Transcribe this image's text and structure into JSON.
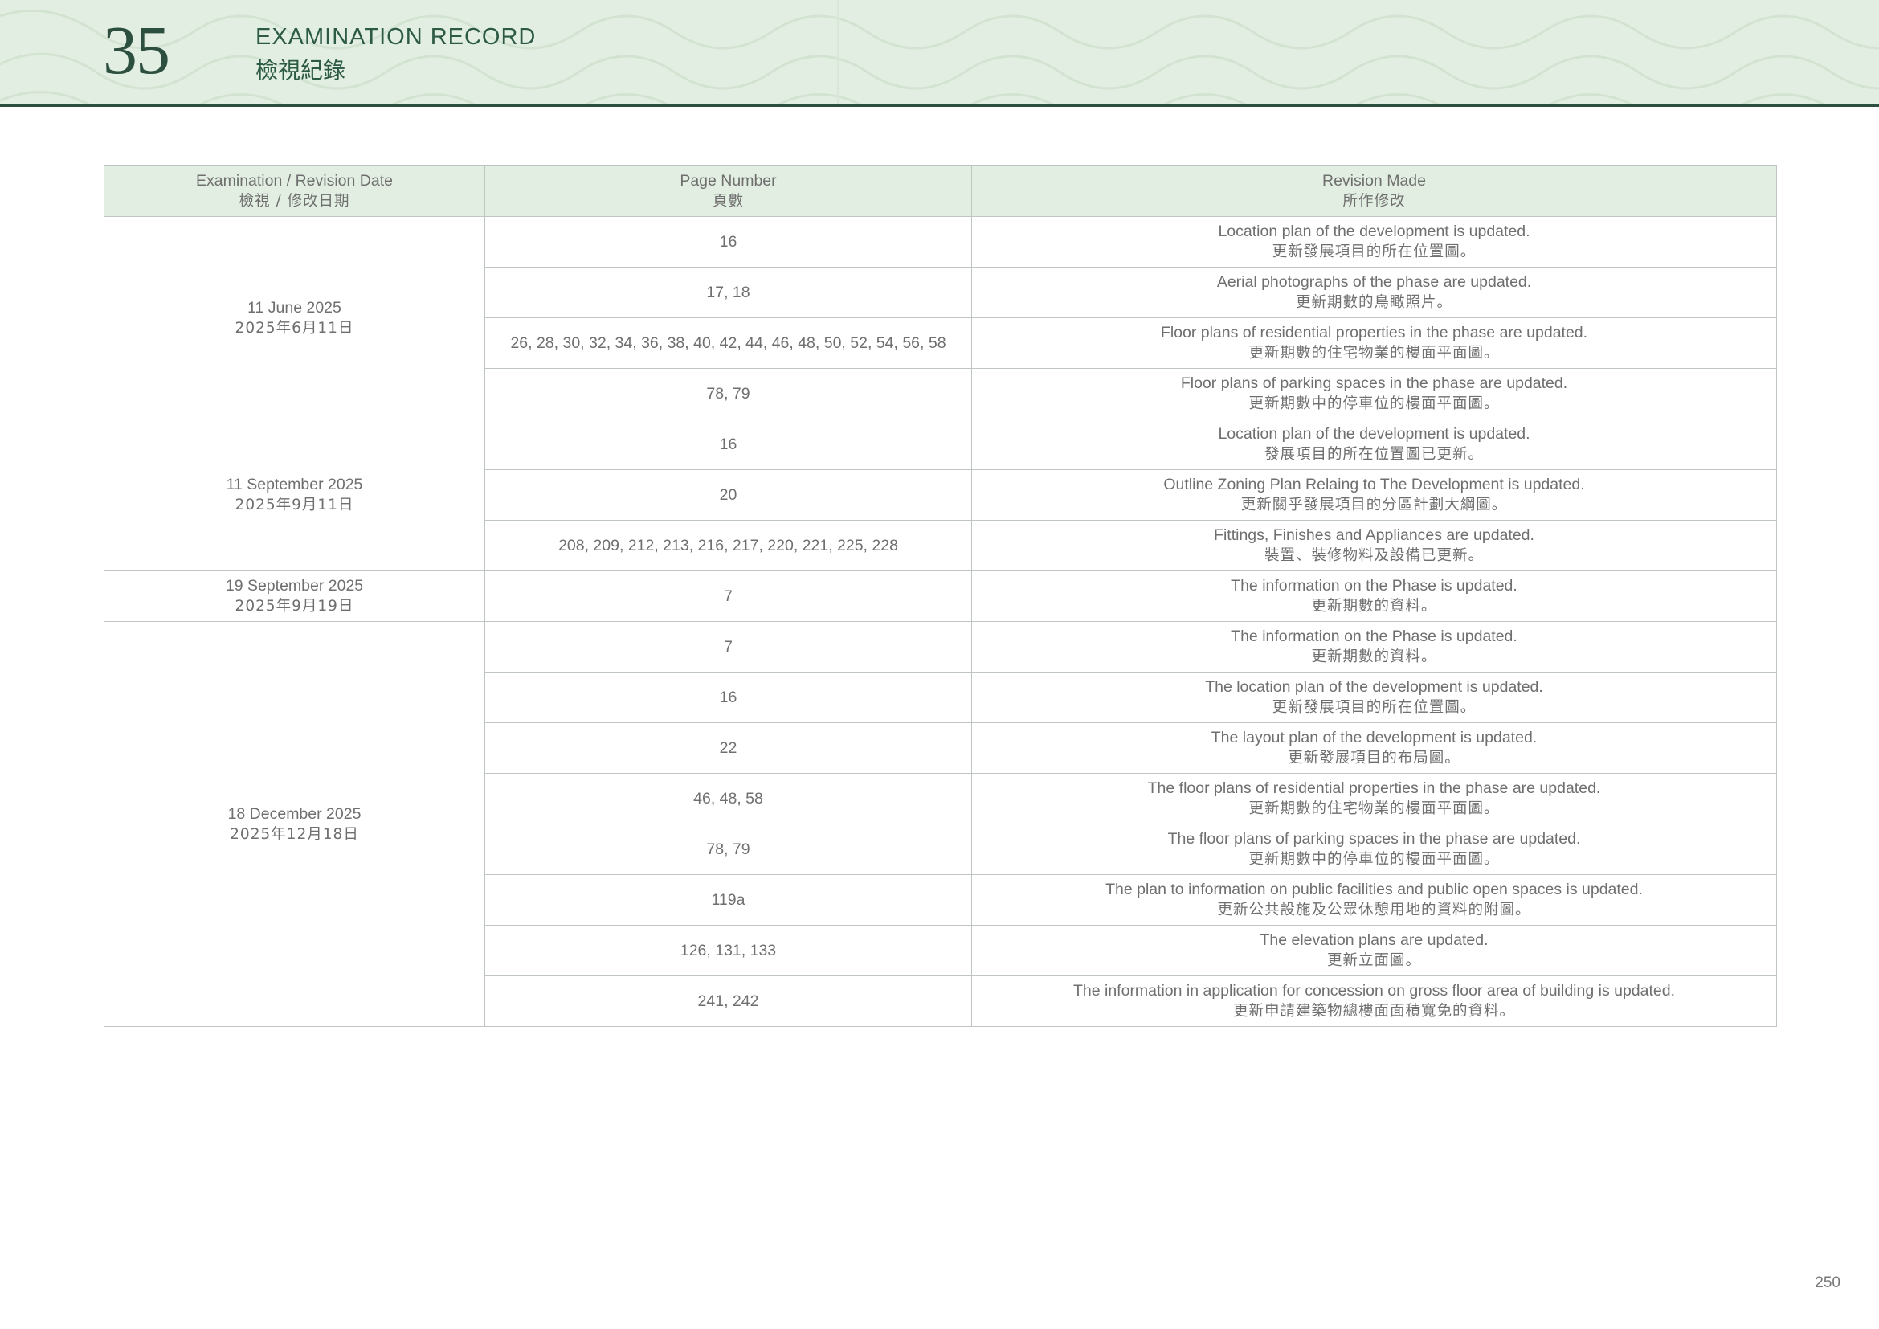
{
  "header": {
    "section_number": "35",
    "title_en": "EXAMINATION RECORD",
    "title_zh": "檢視紀錄"
  },
  "table": {
    "columns": [
      {
        "en": "Examination / Revision Date",
        "zh": "檢視 / 修改日期"
      },
      {
        "en": "Page Number",
        "zh": "頁數"
      },
      {
        "en": "Revision Made",
        "zh": "所作修改"
      }
    ],
    "groups": [
      {
        "date_en": "11 June 2025",
        "date_zh": "2025年6月11日",
        "rows": [
          {
            "pages": "16",
            "rev_en": "Location plan of the development is updated.",
            "rev_zh": "更新發展項目的所在位置圖。"
          },
          {
            "pages": "17, 18",
            "rev_en": "Aerial photographs of the phase are updated.",
            "rev_zh": "更新期數的鳥瞰照片。"
          },
          {
            "pages": "26, 28, 30, 32, 34, 36, 38, 40, 42, 44, 46, 48, 50, 52, 54, 56, 58",
            "rev_en": "Floor plans of residential properties in the phase are updated.",
            "rev_zh": "更新期數的住宅物業的樓面平面圖。"
          },
          {
            "pages": "78, 79",
            "rev_en": "Floor plans of parking spaces in the phase are updated.",
            "rev_zh": "更新期數中的停車位的樓面平面圖。"
          }
        ]
      },
      {
        "date_en": "11 September 2025",
        "date_zh": "2025年9月11日",
        "rows": [
          {
            "pages": "16",
            "rev_en": "Location plan of the development is updated.",
            "rev_zh": "發展項目的所在位置圖已更新。"
          },
          {
            "pages": "20",
            "rev_en": "Outline Zoning Plan Relaing to The Development is updated.",
            "rev_zh": "更新關乎發展項目的分區計劃大綱圖。"
          },
          {
            "pages": "208, 209, 212, 213, 216, 217, 220, 221, 225, 228",
            "rev_en": "Fittings, Finishes and Appliances are updated.",
            "rev_zh": "裝置、裝修物料及設備已更新。"
          }
        ]
      },
      {
        "date_en": "19 September 2025",
        "date_zh": "2025年9月19日",
        "rows": [
          {
            "pages": "7",
            "rev_en": "The information on the Phase is updated.",
            "rev_zh": "更新期數的資料。"
          }
        ]
      },
      {
        "date_en": "18 December 2025",
        "date_zh": "2025年12月18日",
        "rows": [
          {
            "pages": "7",
            "rev_en": "The information on the Phase is updated.",
            "rev_zh": "更新期數的資料。"
          },
          {
            "pages": "16",
            "rev_en": "The location plan of the development is updated.",
            "rev_zh": "更新發展項目的所在位置圖。"
          },
          {
            "pages": "22",
            "rev_en": "The layout plan of the development is updated.",
            "rev_zh": "更新發展項目的布局圖。"
          },
          {
            "pages": "46, 48, 58",
            "rev_en": "The floor plans of residential properties in the phase are updated.",
            "rev_zh": "更新期數的住宅物業的樓面平面圖。"
          },
          {
            "pages": "78, 79",
            "rev_en": "The floor plans of parking spaces in the phase are updated.",
            "rev_zh": "更新期數中的停車位的樓面平面圖。"
          },
          {
            "pages": "119a",
            "rev_en": "The plan to information on public facilities and public open spaces is updated.",
            "rev_zh": "更新公共設施及公眾休憩用地的資料的附圖。"
          },
          {
            "pages": "126, 131, 133",
            "rev_en": "The elevation plans are updated.",
            "rev_zh": "更新立面圖。"
          },
          {
            "pages": "241, 242",
            "rev_en": "The information in application for concession on gross floor area of building is updated.",
            "rev_zh": "更新申請建築物總樓面面積寬免的資料。"
          }
        ]
      }
    ]
  },
  "footer": {
    "page_number": "250"
  },
  "colors": {
    "header_bg": "#e2eee1",
    "header_rule": "#2c4f40",
    "title_text": "#2c5a45",
    "table_border": "#bfc6c1"
  }
}
